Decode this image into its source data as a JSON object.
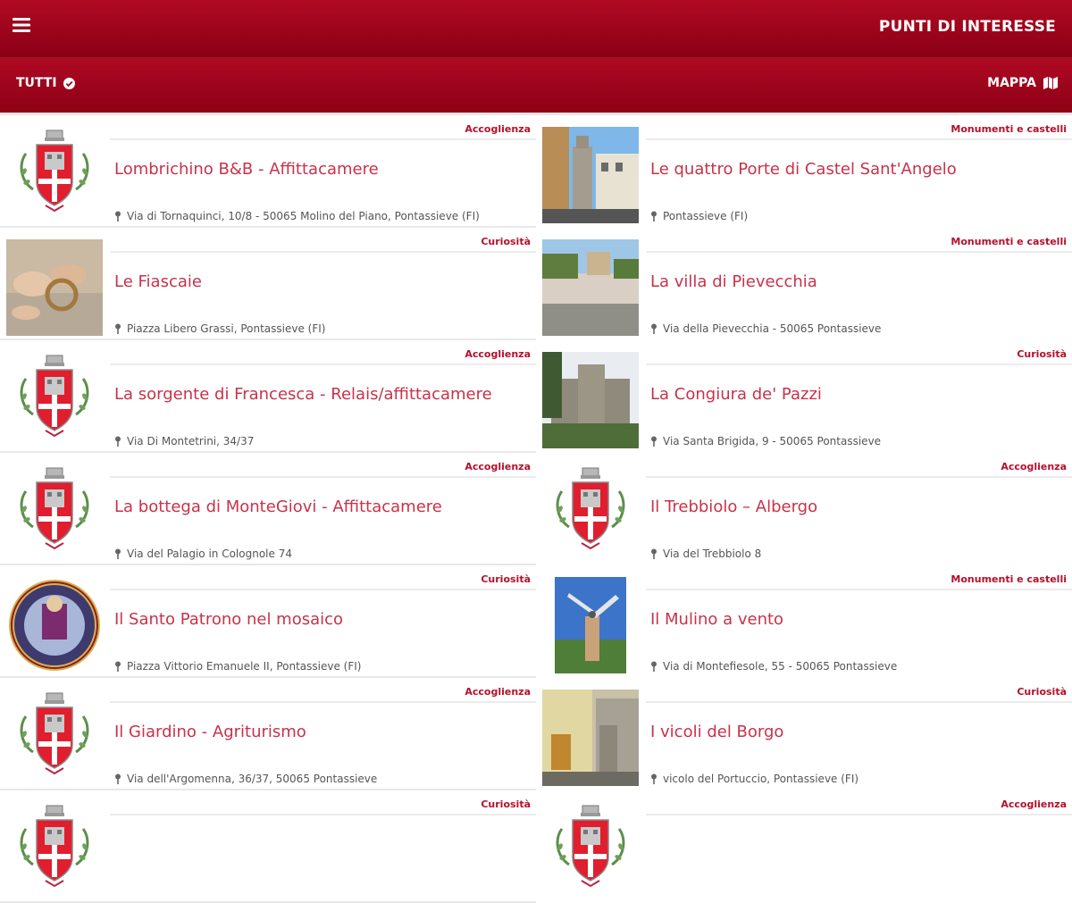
{
  "header": {
    "title": "PUNTI DI INTERESSE",
    "menu_icon": "hamburger-icon"
  },
  "toolbar": {
    "filter_label": "TUTTI",
    "filter_icon": "check-circle-icon",
    "map_label": "MAPPA",
    "map_icon": "map-icon"
  },
  "colors": {
    "brand": "#a0061c",
    "title_text": "#c8324a",
    "category_text": "#b5102a"
  },
  "items": [
    {
      "category": "Accoglienza",
      "title": "Lombrichino B&B - Affittacamere",
      "address": "Via di Tornaquinci, 10/8 - 50065 Molino del Piano, Pontassieve (FI)",
      "image": "coat-of-arms"
    },
    {
      "category": "Monumenti e castelli",
      "title": "Le quattro Porte di Castel Sant'Angelo",
      "address": "Pontassieve (FI)",
      "image": "photo-tower-street"
    },
    {
      "category": "Curiosità",
      "title": "Le Fiascaie",
      "address": "Piazza Libero Grassi, Pontassieve (FI)",
      "image": "photo-weaving-hands"
    },
    {
      "category": "Monumenti e castelli",
      "title": "La villa di Pievecchia",
      "address": "Via della Pievecchia - 50065 Pontassieve",
      "image": "photo-villa-wall"
    },
    {
      "category": "Accoglienza",
      "title": "La sorgente di Francesca - Relais/affittacamere",
      "address": "Via Di Montetrini, 34/37",
      "image": "coat-of-arms"
    },
    {
      "category": "Curiosità",
      "title": "La Congiura de' Pazzi",
      "address": "Via Santa Brigida, 9 - 50065 Pontassieve",
      "image": "photo-castle"
    },
    {
      "category": "Accoglienza",
      "title": "La bottega di MonteGiovi - Affittacamere",
      "address": "Via del Palagio in Colognole 74",
      "image": "coat-of-arms"
    },
    {
      "category": "Accoglienza",
      "title": "Il Trebbiolo – Albergo",
      "address": "Via del Trebbiolo 8",
      "image": "coat-of-arms"
    },
    {
      "category": "Curiosità",
      "title": "Il Santo Patrono nel mosaico",
      "address": "Piazza Vittorio Emanuele II, Pontassieve (FI)",
      "image": "photo-mosaic"
    },
    {
      "category": "Monumenti e castelli",
      "title": "Il Mulino a vento",
      "address": "Via di Montefiesole, 55 - 50065 Pontassieve",
      "image": "photo-windmill"
    },
    {
      "category": "Accoglienza",
      "title": "Il Giardino - Agriturismo",
      "address": "Via dell'Argomenna, 36/37, 50065 Pontassieve",
      "image": "coat-of-arms"
    },
    {
      "category": "Curiosità",
      "title": "I vicoli del Borgo",
      "address": "vicolo del Portuccio, Pontassieve (FI)",
      "image": "photo-alley"
    },
    {
      "category": "Curiosità",
      "title": "",
      "address": "",
      "image": "coat-of-arms"
    },
    {
      "category": "Accoglienza",
      "title": "",
      "address": "",
      "image": "coat-of-arms"
    }
  ]
}
